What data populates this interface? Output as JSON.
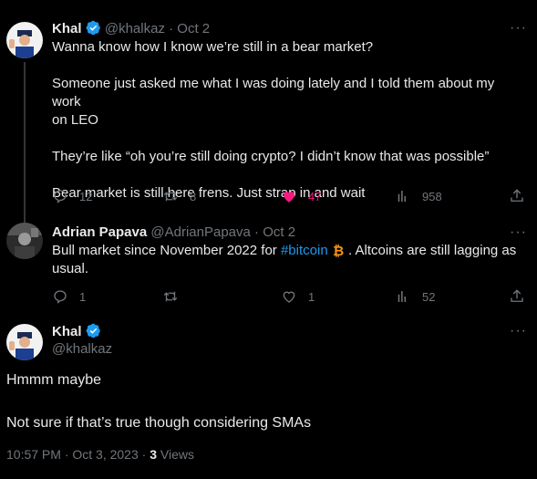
{
  "tweet1": {
    "name": "Khal",
    "handle": "@khalkaz",
    "sep": "·",
    "date": "Oct 2",
    "more": "···",
    "lines": [
      "Wanna know how I know we’re still in a bear market?",
      "Someone just asked me what I was doing lately and I told them about my work",
      "on LEO",
      "They’re like “oh you’re still doing crypto? I didn’t know that was possible”",
      "Bear market is still here frens. Just strap in and wait"
    ],
    "replies": "12",
    "retweets": "8",
    "likes": "47",
    "views": "958"
  },
  "tweet2": {
    "name": "Adrian Papava",
    "handle": "@AdrianPapava",
    "sep": "·",
    "date": "Oct 2",
    "more": "···",
    "text_before": "Bull market since November 2022 for ",
    "hashtag": "#bitcoin",
    "text_after": " . Altcoins are still lagging as",
    "line2": "usual.",
    "replies": "1",
    "retweets": "",
    "likes": "1",
    "views": "52"
  },
  "main": {
    "name": "Khal",
    "handle": "@khalkaz",
    "more": "···",
    "line1": "Hmmm maybe",
    "line2": "Not sure if that’s true though considering SMAs",
    "timestamp": "10:57 PM · Oct 3, 2023 ·",
    "views_count": "3",
    "views_label": "Views"
  },
  "colors": {
    "accent": "#1d9bf0",
    "like": "#f91880",
    "muted": "#71767b"
  }
}
